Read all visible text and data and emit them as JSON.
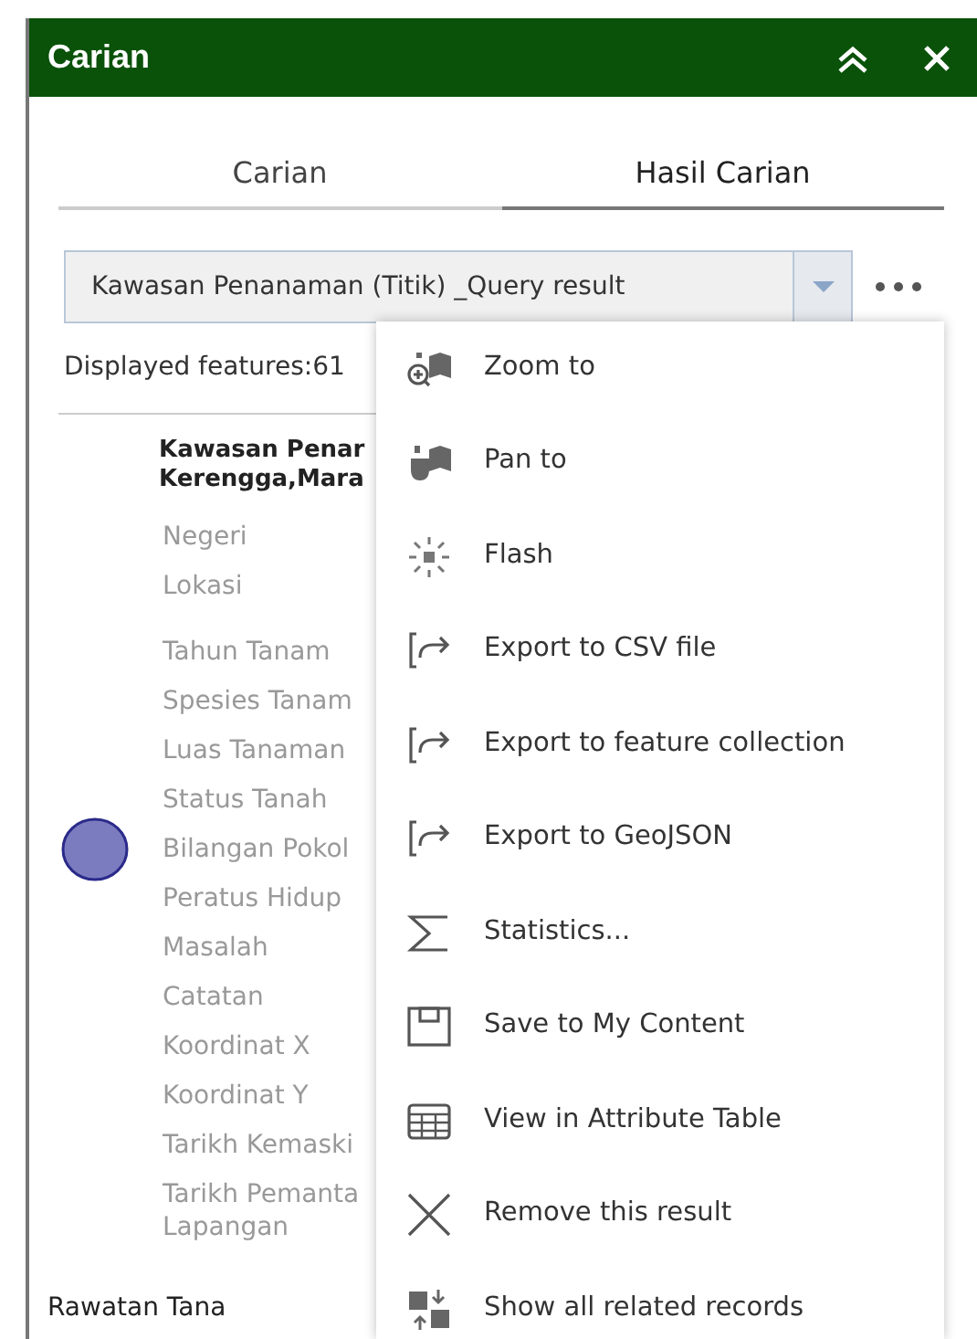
{
  "panel": {
    "title": "Carian"
  },
  "tabs": [
    {
      "label": "Carian",
      "selected": false
    },
    {
      "label": "Hasil Carian",
      "selected": true
    }
  ],
  "layer_select": {
    "value": "Kawasan Penanaman (Titik) _Query result"
  },
  "displayed_features": "Displayed features:61",
  "feature": {
    "title": "Kawasan Penar\nKerengga,Mara",
    "color": "#7b7bbf",
    "attribute_groups": [
      [
        "Negeri",
        "Lokasi"
      ],
      [
        "Tahun Tanam",
        "Spesies Tanam",
        "Luas Tanaman",
        "Status Tanah",
        "Bilangan Pokol",
        "Peratus Hidup",
        "Masalah",
        "Catatan",
        "Koordinat X",
        "Koordinat Y",
        "Tarikh Kemaski",
        "Tarikh Pemanta\nLapangan"
      ]
    ],
    "related_title": "Rawatan Tana"
  },
  "menu": [
    {
      "kind": "zoom",
      "label": "Zoom to"
    },
    {
      "kind": "pan",
      "label": "Pan to"
    },
    {
      "kind": "flash",
      "label": "Flash"
    },
    {
      "kind": "export",
      "label": "Export to CSV file"
    },
    {
      "kind": "export",
      "label": "Export to feature collection"
    },
    {
      "kind": "export",
      "label": "Export to GeoJSON"
    },
    {
      "kind": "statistics",
      "label": "Statistics..."
    },
    {
      "kind": "save",
      "label": "Save to My Content"
    },
    {
      "kind": "table",
      "label": "View in Attribute Table"
    },
    {
      "kind": "remove",
      "label": "Remove this result"
    },
    {
      "kind": "related",
      "label": "Show all related records"
    }
  ]
}
